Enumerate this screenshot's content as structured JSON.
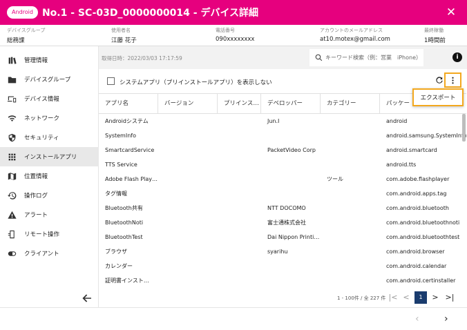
{
  "header": {
    "badge": "Android",
    "title": "No.1 - SC-03D_0000000014 - デバイス詳細",
    "close": "✕"
  },
  "info": [
    {
      "label": "デバイスグループ",
      "value": "総務課"
    },
    {
      "label": "使用者名",
      "value": "江藤 花子"
    },
    {
      "label": "電話番号",
      "value": "090xxxxxxxx"
    },
    {
      "label": "アカウントのメールアドレス",
      "value": "at10.motex@gmail.com"
    },
    {
      "label": "最終稼働",
      "value": "1時間前"
    }
  ],
  "sidebar": {
    "items": [
      {
        "label": "管理情報",
        "icon": "books-icon"
      },
      {
        "label": "デバイスグループ",
        "icon": "folder-icon"
      },
      {
        "label": "デバイス情報",
        "icon": "devices-icon"
      },
      {
        "label": "ネットワーク",
        "icon": "wifi-icon"
      },
      {
        "label": "セキュリティ",
        "icon": "shield-icon"
      },
      {
        "label": "インストールアプリ",
        "icon": "apps-grid-icon"
      },
      {
        "label": "位置情報",
        "icon": "map-icon"
      },
      {
        "label": "操作ログ",
        "icon": "history-icon"
      },
      {
        "label": "アラート",
        "icon": "warning-icon"
      },
      {
        "label": "リモート操作",
        "icon": "remote-phone-icon"
      },
      {
        "label": "クライアント",
        "icon": "client-pill-icon"
      }
    ],
    "active_index": 5
  },
  "toolbar": {
    "fetch_time": "取得日時：2022/03/03 17:17:59",
    "search_placeholder": "キーワード検索（例：営業　iPhone）",
    "filter_label": "システムアプリ（プリインストールアプリ）を表示しない",
    "info_glyph": "i"
  },
  "menu": {
    "export_label": "エクスポート"
  },
  "table": {
    "columns": [
      "アプリ名",
      "バージョン",
      "プリインス…",
      "デベロッパー",
      "カテゴリー",
      "パッケー"
    ],
    "rows": [
      [
        "Androidシステム",
        "",
        "",
        "Jun.I",
        "",
        "android"
      ],
      [
        "SystemInfo",
        "",
        "",
        "",
        "",
        "android.samsung.SystemInfo"
      ],
      [
        "SmartcardService",
        "",
        "",
        "PacketVideo Corp",
        "",
        "android.smartcard"
      ],
      [
        "TTS Service",
        "",
        "",
        "",
        "",
        "android.tts"
      ],
      [
        "Adobe Flash Play…",
        "",
        "",
        "",
        "ツール",
        "com.adobe.flashplayer"
      ],
      [
        "タグ情報",
        "",
        "",
        "",
        "",
        "com.android.apps.tag"
      ],
      [
        "Bluetooth共有",
        "",
        "",
        "NTT DOCOMO",
        "",
        "com.android.bluetooth"
      ],
      [
        "BluetoothNoti",
        "",
        "",
        "富士通株式会社",
        "",
        "com.android.bluetoothnoti"
      ],
      [
        "BluetoothTest",
        "",
        "",
        "Dai Nippon Printi…",
        "",
        "com.android.bluetoothtest"
      ],
      [
        "ブラウザ",
        "",
        "",
        "syarihu",
        "",
        "com.android.browser"
      ],
      [
        "カレンダー",
        "",
        "",
        "",
        "",
        "com.android.calendar"
      ],
      [
        "証明書インスト…",
        "",
        "",
        "",
        "",
        "com.android.certinstaller"
      ]
    ]
  },
  "pagination": {
    "info": "1 - 100件 / 全 227 件",
    "current_page": "1",
    "first": "|<",
    "prev": "<",
    "next": ">",
    "last": ">|"
  },
  "footer": {
    "prev": "‹",
    "next": "›"
  },
  "colors": {
    "brand": "#e6007e",
    "highlight": "#f3a81e",
    "page_active": "#1a3c6e"
  }
}
